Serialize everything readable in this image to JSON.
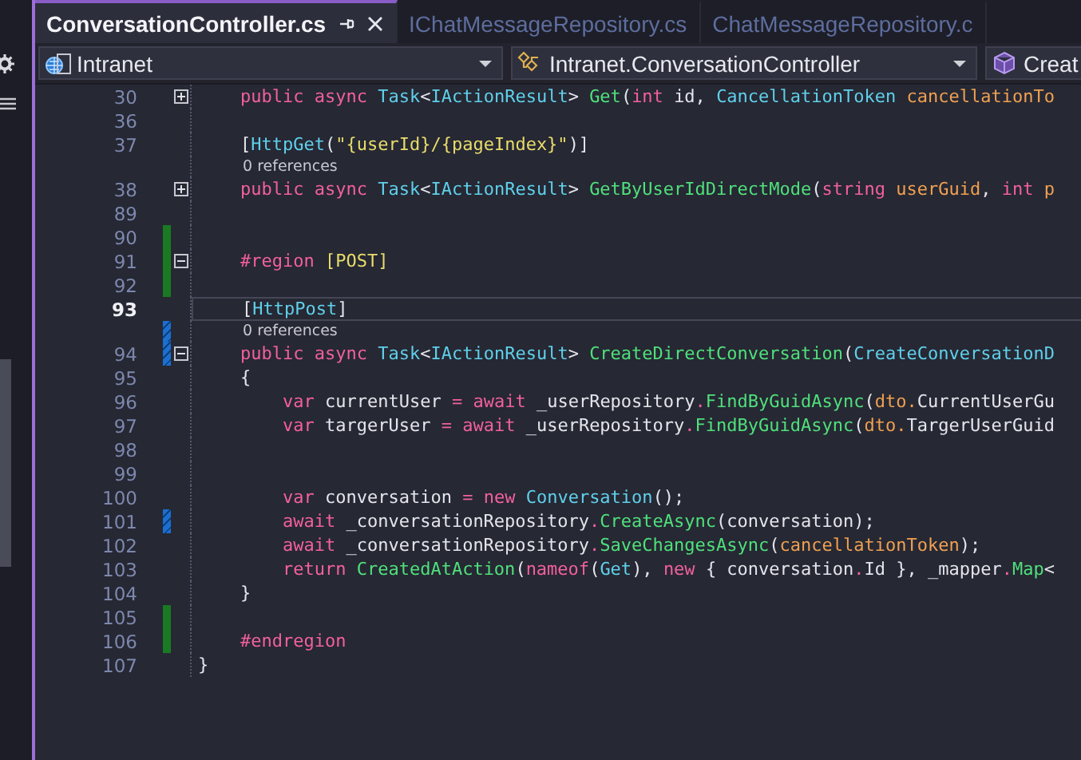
{
  "tabs": [
    {
      "label": "ConversationController.cs",
      "selected": true
    },
    {
      "label": "IChatMessageRepository.cs",
      "selected": false
    },
    {
      "label": "ChatMessageRepository.c",
      "selected": false
    }
  ],
  "navigation_bar": [
    {
      "label": "Intranet",
      "caret": true
    },
    {
      "label": "Intranet.ConversationController",
      "caret": true
    },
    {
      "label": "Creat",
      "caret": false
    }
  ],
  "editor": {
    "rows": [
      {
        "kind": "code",
        "number": "30",
        "collapsed": true,
        "tokens": [
          {
            "text": "    public async ",
            "kind": "kw"
          },
          {
            "text": "Task",
            "kind": "type"
          },
          {
            "text": "<",
            "kind": "plain"
          },
          {
            "text": "IActionResult",
            "kind": "type"
          },
          {
            "text": "> ",
            "kind": "plain"
          },
          {
            "text": "Get",
            "kind": "method"
          },
          {
            "text": "(",
            "kind": "plain"
          },
          {
            "text": "int ",
            "kind": "kw"
          },
          {
            "text": "id, ",
            "kind": "plain"
          },
          {
            "text": "CancellationToken ",
            "kind": "type"
          },
          {
            "text": "cancellationTo",
            "kind": "param"
          }
        ]
      },
      {
        "kind": "code",
        "number": "36",
        "tokens": []
      },
      {
        "kind": "code",
        "number": "37",
        "tokens": [
          {
            "text": "    [",
            "kind": "plain"
          },
          {
            "text": "HttpGet",
            "kind": "type"
          },
          {
            "text": "(",
            "kind": "plain"
          },
          {
            "text": "\"{userId}/{pageIndex}\"",
            "kind": "str"
          },
          {
            "text": ")]",
            "kind": "plain"
          }
        ]
      },
      {
        "kind": "lens",
        "text": "0 references"
      },
      {
        "kind": "code",
        "number": "38",
        "collapsed": true,
        "tokens": [
          {
            "text": "    public async ",
            "kind": "kw"
          },
          {
            "text": "Task",
            "kind": "type"
          },
          {
            "text": "<",
            "kind": "plain"
          },
          {
            "text": "IActionResult",
            "kind": "type"
          },
          {
            "text": "> ",
            "kind": "plain"
          },
          {
            "text": "GetByUserIdDirectMode",
            "kind": "method"
          },
          {
            "text": "(",
            "kind": "plain"
          },
          {
            "text": "string ",
            "kind": "kw"
          },
          {
            "text": "userGuid",
            "kind": "param"
          },
          {
            "text": ", ",
            "kind": "plain"
          },
          {
            "text": "int ",
            "kind": "kw"
          },
          {
            "text": "p",
            "kind": "param"
          }
        ]
      },
      {
        "kind": "code",
        "number": "89",
        "tokens": []
      },
      {
        "kind": "code",
        "number": "90",
        "saved": true,
        "tokens": []
      },
      {
        "kind": "code",
        "number": "91",
        "saved": true,
        "collapsed": false,
        "tokens": [
          {
            "text": "    #region ",
            "kind": "kw"
          },
          {
            "text": "[POST]",
            "kind": "str"
          }
        ]
      },
      {
        "kind": "code",
        "number": "92",
        "saved": true,
        "tokens": []
      },
      {
        "kind": "code",
        "number": "93",
        "current": true,
        "tokens": [
          {
            "text": "    [",
            "kind": "plain"
          },
          {
            "text": "HttpPost",
            "kind": "type"
          },
          {
            "text": "]",
            "kind": "plain"
          }
        ]
      },
      {
        "kind": "lens",
        "text": "0 references",
        "saved": false
      },
      {
        "kind": "code",
        "number": "94",
        "saved": false,
        "collapsed": false,
        "tokens": [
          {
            "text": "    public async ",
            "kind": "kw"
          },
          {
            "text": "Task",
            "kind": "type"
          },
          {
            "text": "<",
            "kind": "plain"
          },
          {
            "text": "IActionResult",
            "kind": "type"
          },
          {
            "text": "> ",
            "kind": "plain"
          },
          {
            "text": "CreateDirectConversation",
            "kind": "method"
          },
          {
            "text": "(",
            "kind": "plain"
          },
          {
            "text": "CreateConversationD",
            "kind": "type"
          }
        ]
      },
      {
        "kind": "code",
        "number": "95",
        "tokens": [
          {
            "text": "    {",
            "kind": "plain"
          }
        ]
      },
      {
        "kind": "code",
        "number": "96",
        "tokens": [
          {
            "text": "        var ",
            "kind": "kw"
          },
          {
            "text": "currentUser ",
            "kind": "plain"
          },
          {
            "text": "= await ",
            "kind": "kw"
          },
          {
            "text": "_userRepository",
            "kind": "plain"
          },
          {
            "text": ".",
            "kind": "kw"
          },
          {
            "text": "FindByGuidAsync",
            "kind": "method"
          },
          {
            "text": "(",
            "kind": "plain"
          },
          {
            "text": "dto.",
            "kind": "param"
          },
          {
            "text": "CurrentUserGu",
            "kind": "plain"
          }
        ]
      },
      {
        "kind": "code",
        "number": "97",
        "tokens": [
          {
            "text": "        var ",
            "kind": "kw"
          },
          {
            "text": "targerUser ",
            "kind": "plain"
          },
          {
            "text": "= await ",
            "kind": "kw"
          },
          {
            "text": "_userRepository",
            "kind": "plain"
          },
          {
            "text": ".",
            "kind": "kw"
          },
          {
            "text": "FindByGuidAsync",
            "kind": "method"
          },
          {
            "text": "(",
            "kind": "plain"
          },
          {
            "text": "dto.",
            "kind": "param"
          },
          {
            "text": "TargerUserGuid",
            "kind": "plain"
          }
        ]
      },
      {
        "kind": "code",
        "number": "98",
        "tokens": []
      },
      {
        "kind": "code",
        "number": "99",
        "tokens": []
      },
      {
        "kind": "code",
        "number": "100",
        "tokens": [
          {
            "text": "        var ",
            "kind": "kw"
          },
          {
            "text": "conversation ",
            "kind": "plain"
          },
          {
            "text": "= new ",
            "kind": "kw"
          },
          {
            "text": "Conversation",
            "kind": "type"
          },
          {
            "text": "();",
            "kind": "plain"
          }
        ]
      },
      {
        "kind": "code",
        "number": "101",
        "saved": false,
        "tokens": [
          {
            "text": "        await ",
            "kind": "kw"
          },
          {
            "text": "_conversationRepository",
            "kind": "plain"
          },
          {
            "text": ".",
            "kind": "kw"
          },
          {
            "text": "CreateAsync",
            "kind": "method"
          },
          {
            "text": "(conversation);",
            "kind": "plain"
          }
        ]
      },
      {
        "kind": "code",
        "number": "102",
        "tokens": [
          {
            "text": "        await ",
            "kind": "kw"
          },
          {
            "text": "_conversationRepository",
            "kind": "plain"
          },
          {
            "text": ".",
            "kind": "kw"
          },
          {
            "text": "SaveChangesAsync",
            "kind": "method"
          },
          {
            "text": "(",
            "kind": "plain"
          },
          {
            "text": "cancellationToken",
            "kind": "param"
          },
          {
            "text": ");",
            "kind": "plain"
          }
        ]
      },
      {
        "kind": "code",
        "number": "103",
        "tokens": [
          {
            "text": "        return ",
            "kind": "kw"
          },
          {
            "text": "CreatedAtAction",
            "kind": "method"
          },
          {
            "text": "(",
            "kind": "plain"
          },
          {
            "text": "nameof",
            "kind": "kw"
          },
          {
            "text": "(",
            "kind": "plain"
          },
          {
            "text": "Get",
            "kind": "type"
          },
          {
            "text": "), ",
            "kind": "plain"
          },
          {
            "text": "new ",
            "kind": "kw"
          },
          {
            "text": "{ conversation",
            "kind": "plain"
          },
          {
            "text": ".",
            "kind": "kw"
          },
          {
            "text": "Id }, _mapper",
            "kind": "plain"
          },
          {
            "text": ".",
            "kind": "kw"
          },
          {
            "text": "Map",
            "kind": "method"
          },
          {
            "text": "<",
            "kind": "plain"
          }
        ]
      },
      {
        "kind": "code",
        "number": "104",
        "tokens": [
          {
            "text": "    }",
            "kind": "plain"
          }
        ]
      },
      {
        "kind": "code",
        "number": "105",
        "saved": true,
        "tokens": []
      },
      {
        "kind": "code",
        "number": "106",
        "saved": true,
        "tokens": [
          {
            "text": "    #endregion",
            "kind": "kw"
          }
        ]
      },
      {
        "kind": "code",
        "number": "107",
        "tokens": [
          {
            "text": "}",
            "kind": "plain"
          }
        ]
      }
    ]
  }
}
